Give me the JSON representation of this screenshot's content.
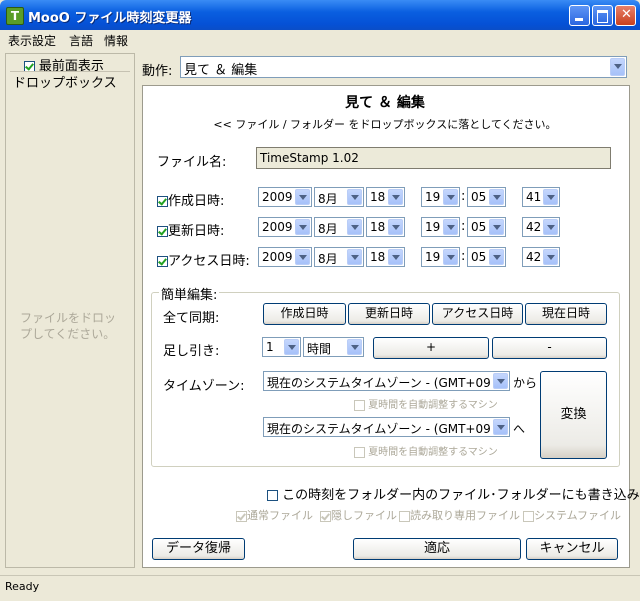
{
  "window": {
    "title": "MooO ファイル時刻変更器",
    "icon_letter": "T"
  },
  "menu": [
    "表示設定",
    "言語",
    "情報"
  ],
  "sidebar": {
    "topmost_label": "最前面表示",
    "topmost_checked": true,
    "dropbox_label": "ドロップボックス",
    "dropbox_hint": "ファイルをドロップしてください。"
  },
  "action": {
    "label": "動作:",
    "value": "見て ＆ 編集"
  },
  "main": {
    "heading": "見て ＆ 編集",
    "subheading": "<< ファイル / フォルダー をドロップボックスに落としてください。",
    "filename_label": "ファイル名:",
    "filename_value": "TimeStamp 1.02"
  },
  "timestamps": [
    {
      "label": "作成日時:",
      "checked": true,
      "year": "2009",
      "month": "8月",
      "day": "18",
      "hour": "19",
      "minute": "05",
      "second": "41"
    },
    {
      "label": "更新日時:",
      "checked": true,
      "year": "2009",
      "month": "8月",
      "day": "18",
      "hour": "19",
      "minute": "05",
      "second": "42"
    },
    {
      "label": "アクセス日時:",
      "checked": true,
      "year": "2009",
      "month": "8月",
      "day": "18",
      "hour": "19",
      "minute": "05",
      "second": "42"
    }
  ],
  "quick_edit": {
    "group_label": "簡単編集:",
    "sync_label": "全て同期:",
    "sync_buttons": [
      "作成日時",
      "更新日時",
      "アクセス日時",
      "現在日時"
    ],
    "offset_label": "足し引き:",
    "offset_amount": "1",
    "offset_unit": "時間",
    "plus": "+",
    "minus": "-",
    "timezone_label": "タイムゾーン:",
    "from_zone": "現在のシステムタイムゾーン - (GMT+09",
    "from_suffix": "から",
    "from_dst": "夏時間を自動調整するマシン",
    "to_zone": "現在のシステムタイムゾーン - (GMT+09",
    "to_suffix": "へ",
    "to_dst": "夏時間を自動調整するマシン",
    "convert": "変換"
  },
  "write_options": {
    "main_label": "この時刻をフォルダー内のファイル･フォルダーにも書き込み",
    "main_checked": false,
    "subs": [
      {
        "label": "通常ファイル",
        "checked": true
      },
      {
        "label": "隠しファイル",
        "checked": true
      },
      {
        "label": "読み取り専用ファイル",
        "checked": false
      },
      {
        "label": "システムファイル",
        "checked": false
      }
    ]
  },
  "footer": {
    "restore": "データ復帰",
    "apply": "適応",
    "cancel": "キャンセル"
  },
  "status": "Ready"
}
